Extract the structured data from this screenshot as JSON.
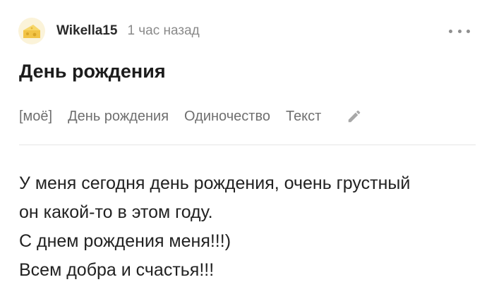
{
  "post": {
    "author": "Wikella15",
    "time": "1 час назад",
    "title": "День рождения",
    "tags": [
      "[моё]",
      "День рождения",
      "Одиночество",
      "Текст"
    ],
    "body_lines": [
      "У меня сегодня день рождения, очень грустный",
      "он какой-то в этом году.",
      "С днем рождения меня!!!)",
      "Всем добра и счастья!!!"
    ]
  },
  "icons": {
    "avatar": "cheese-avatar-icon",
    "more": "more-dots-icon",
    "edit": "pencil-icon"
  }
}
